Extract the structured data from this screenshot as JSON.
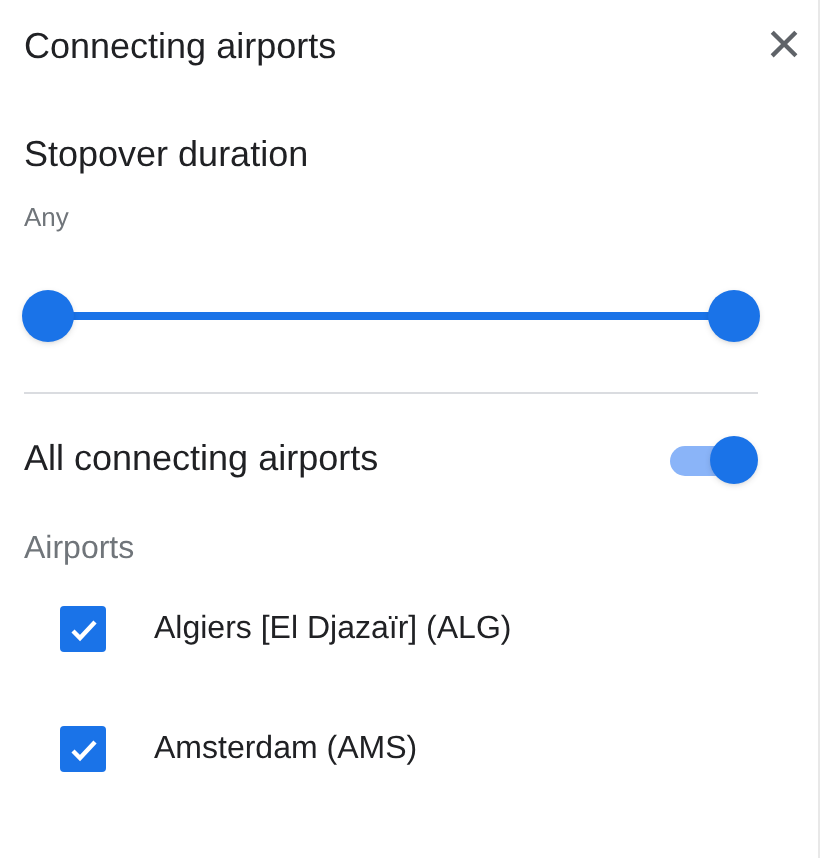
{
  "dialog": {
    "title": "Connecting airports",
    "close": "×"
  },
  "stopover": {
    "label": "Stopover duration",
    "value": "Any",
    "thumbs": [
      {
        "level": 0
      },
      {
        "level": 1
      }
    ]
  },
  "all_airports": {
    "label": "All connecting airports",
    "on": true
  },
  "airports": {
    "heading": "Airports",
    "items": [
      {
        "label": "Algiers [El Djazaïr] (ALG)",
        "checked": true
      },
      {
        "label": "Amsterdam (AMS)",
        "checked": true
      }
    ]
  }
}
